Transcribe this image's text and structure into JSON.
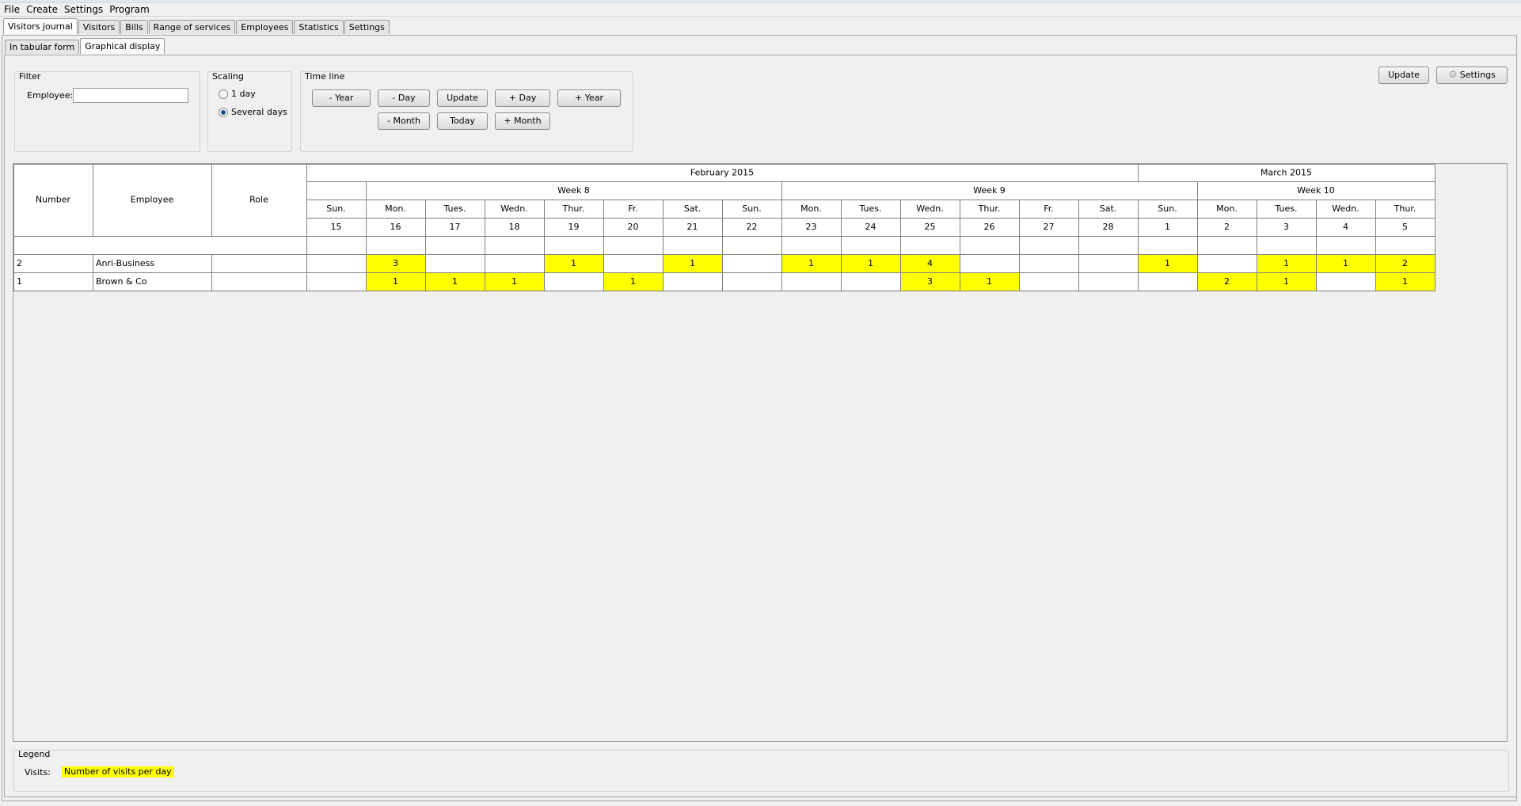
{
  "menu": [
    "File",
    "Create",
    "Settings",
    "Program"
  ],
  "tabs": [
    "Visitors journal",
    "Visitors",
    "Bills",
    "Range of services",
    "Employees",
    "Statistics",
    "Settings"
  ],
  "subtabs": [
    "In tabular form",
    "Graphical display"
  ],
  "filter": {
    "title": "Filter",
    "employee_label": "Employee:",
    "employee_value": ""
  },
  "scaling": {
    "title": "Scaling",
    "option_1": "1 day",
    "option_2": "Several days",
    "selected": "Several days"
  },
  "timeline": {
    "title": "Time line",
    "minus_year": "- Year",
    "minus_day": "- Day",
    "update": "Update",
    "plus_day": "+ Day",
    "plus_year": "+ Year",
    "minus_month": "- Month",
    "today": "Today",
    "plus_month": "+ Month"
  },
  "top_update": "Update",
  "top_settings": "Settings",
  "grid": {
    "headers": {
      "number": "Number",
      "employee": "Employee",
      "role": "Role"
    },
    "months": [
      {
        "label": "February 2015",
        "span": 14
      },
      {
        "label": "March 2015",
        "span": 5
      }
    ],
    "weeks": [
      {
        "label": "",
        "span": 1
      },
      {
        "label": "Week 8",
        "span": 7
      },
      {
        "label": "Week 9",
        "span": 7
      },
      {
        "label": "Week 10",
        "span": 4
      }
    ],
    "weekdays": [
      "Sun.",
      "Mon.",
      "Tues.",
      "Wedn.",
      "Thur.",
      "Fr.",
      "Sat.",
      "Sun.",
      "Mon.",
      "Tues.",
      "Wedn.",
      "Thur.",
      "Fr.",
      "Sat.",
      "Sun.",
      "Mon.",
      "Tues.",
      "Wedn.",
      "Thur."
    ],
    "dates": [
      "15",
      "16",
      "17",
      "18",
      "19",
      "20",
      "21",
      "22",
      "23",
      "24",
      "25",
      "26",
      "27",
      "28",
      "1",
      "2",
      "3",
      "4",
      "5"
    ],
    "rows": [
      {
        "number": "2",
        "employee": "Anri-Business",
        "role": "",
        "visits": [
          null,
          3,
          null,
          null,
          1,
          null,
          1,
          null,
          1,
          1,
          4,
          null,
          null,
          null,
          1,
          null,
          1,
          1,
          2
        ]
      },
      {
        "number": "1",
        "employee": "Brown & Co",
        "role": "",
        "visits": [
          null,
          1,
          1,
          1,
          null,
          1,
          null,
          null,
          null,
          null,
          3,
          1,
          null,
          null,
          null,
          2,
          1,
          null,
          1
        ]
      }
    ],
    "highlight_color": "#ffff00"
  },
  "legend": {
    "title": "Legend",
    "label": "Visits:",
    "item": "Number of visits per day",
    "color": "#ffff00"
  }
}
